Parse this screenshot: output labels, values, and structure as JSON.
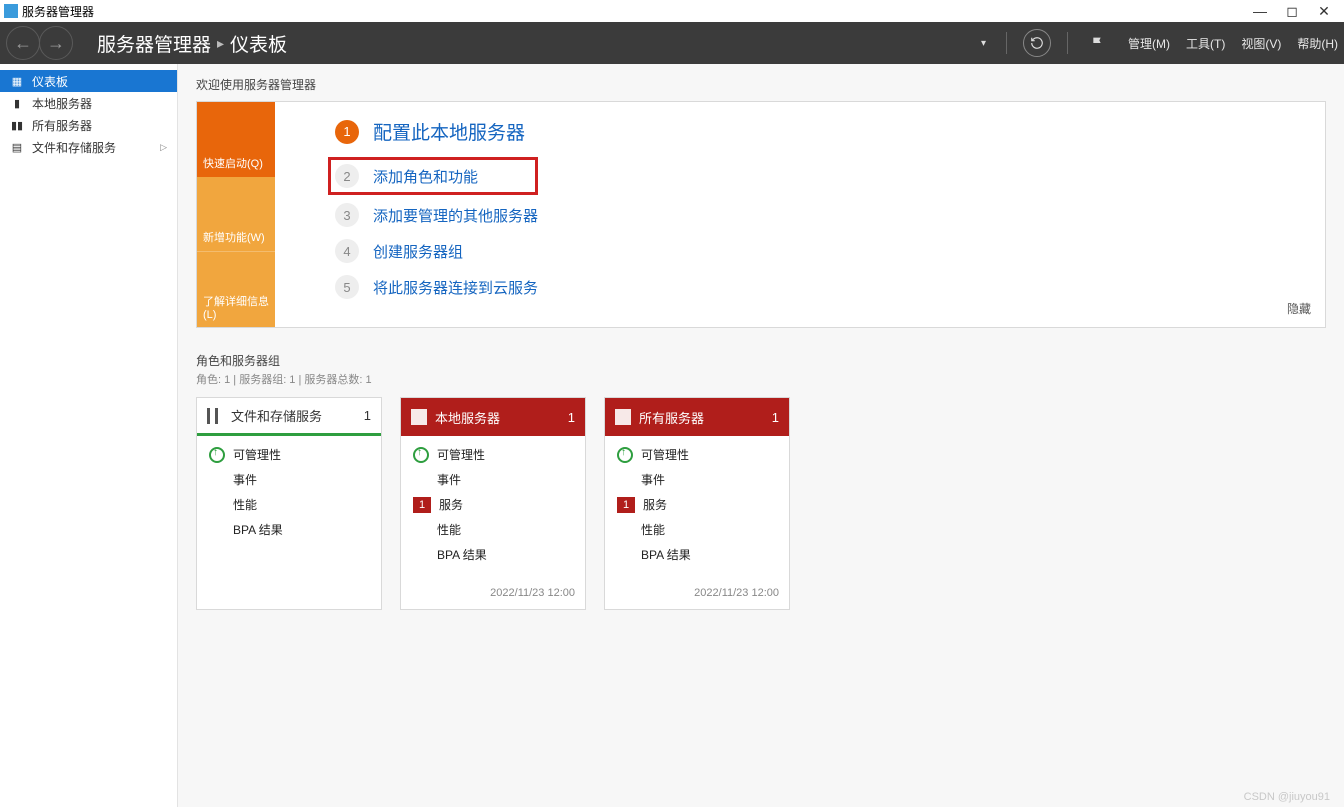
{
  "titlebar": {
    "app_title": "服务器管理器"
  },
  "header": {
    "breadcrumb_root": "服务器管理器",
    "breadcrumb_sep": "•",
    "breadcrumb_page": "仪表板",
    "menu": {
      "manage": "管理(M)",
      "tools": "工具(T)",
      "view": "视图(V)",
      "help": "帮助(H)"
    }
  },
  "sidebar": {
    "items": [
      {
        "label": "仪表板"
      },
      {
        "label": "本地服务器"
      },
      {
        "label": "所有服务器"
      },
      {
        "label": "文件和存储服务"
      }
    ]
  },
  "welcome": {
    "title": "欢迎使用服务器管理器",
    "tabs": {
      "quick": "快速启动(Q)",
      "whatsnew": "新增功能(W)",
      "learnmore": "了解详细信息(L)"
    },
    "steps": [
      {
        "n": "1",
        "label": "配置此本地服务器"
      },
      {
        "n": "2",
        "label": "添加角色和功能"
      },
      {
        "n": "3",
        "label": "添加要管理的其他服务器"
      },
      {
        "n": "4",
        "label": "创建服务器组"
      },
      {
        "n": "5",
        "label": "将此服务器连接到云服务"
      }
    ],
    "hide": "隐藏"
  },
  "groups": {
    "title": "角色和服务器组",
    "sub": "角色: 1 | 服务器组: 1 | 服务器总数: 1",
    "cards": [
      {
        "style": "green",
        "title": "文件和存储服务",
        "count": "1",
        "rows": [
          {
            "icon": "ok",
            "label": "可管理性"
          },
          {
            "icon": "",
            "label": "事件"
          },
          {
            "icon": "",
            "label": "性能"
          },
          {
            "icon": "",
            "label": "BPA 结果"
          }
        ],
        "timestamp": ""
      },
      {
        "style": "red",
        "title": "本地服务器",
        "count": "1",
        "rows": [
          {
            "icon": "ok",
            "label": "可管理性"
          },
          {
            "icon": "",
            "label": "事件"
          },
          {
            "icon": "badge",
            "badge": "1",
            "label": "服务"
          },
          {
            "icon": "",
            "label": "性能"
          },
          {
            "icon": "",
            "label": "BPA 结果"
          }
        ],
        "timestamp": "2022/11/23 12:00"
      },
      {
        "style": "red",
        "title": "所有服务器",
        "count": "1",
        "rows": [
          {
            "icon": "ok",
            "label": "可管理性"
          },
          {
            "icon": "",
            "label": "事件"
          },
          {
            "icon": "badge",
            "badge": "1",
            "label": "服务"
          },
          {
            "icon": "",
            "label": "性能"
          },
          {
            "icon": "",
            "label": "BPA 结果"
          }
        ],
        "timestamp": "2022/11/23 12:00"
      }
    ]
  },
  "watermark": "CSDN @jiuyou91"
}
